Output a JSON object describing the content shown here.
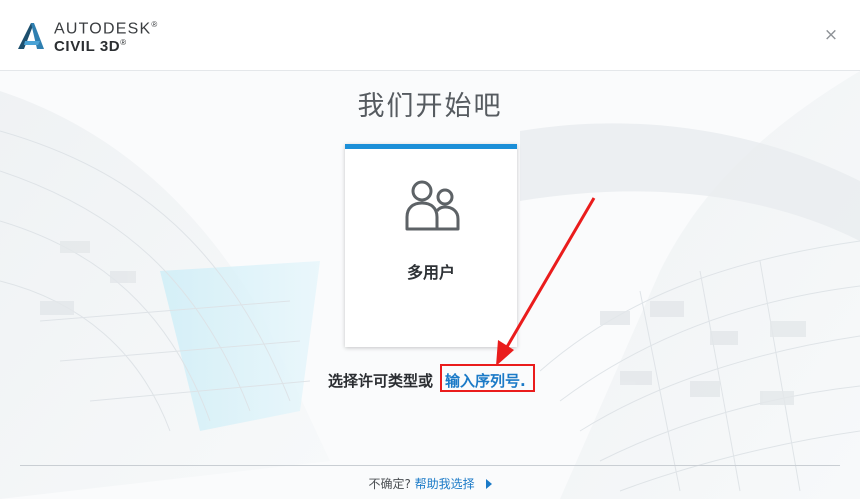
{
  "header": {
    "brand_line1": "AUTODESK",
    "brand_line1_mark": "®",
    "brand_line2": "CIVIL 3D",
    "brand_line2_mark": "®",
    "logo_icon": "autodesk-a-logo",
    "close_icon": "close-icon",
    "close_glyph": "×"
  },
  "main": {
    "title": "我们开始吧",
    "tile": {
      "label": "多用户",
      "icon": "users-icon",
      "accent": "#1c8fd8"
    },
    "prompt": "选择许可类型或",
    "serial_link": "输入序列号",
    "serial_link_suffix": "."
  },
  "footer": {
    "question": "不确定?",
    "help_link": "帮助我选择"
  },
  "colors": {
    "accent": "#1c8fd8",
    "link": "#1b7ac7",
    "annotation": "#ea1c1c"
  }
}
